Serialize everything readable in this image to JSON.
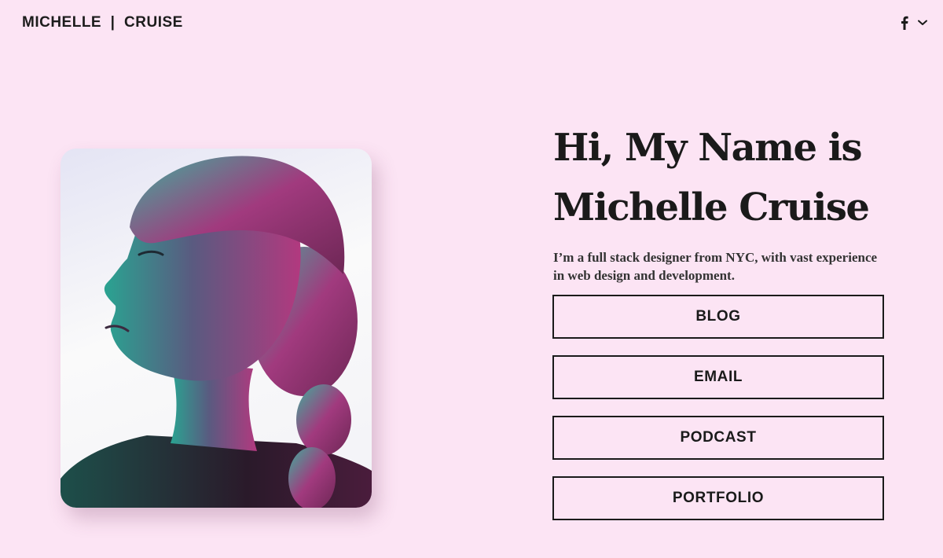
{
  "header": {
    "logo": "MICHELLE  |  CRUISE",
    "social_icon": "facebook-icon",
    "dropdown_icon": "chevron-down-icon"
  },
  "hero": {
    "title_line1": "Hi, My Name is",
    "title_line2": "Michelle Cruise",
    "subtitle": "I’m a full stack designer from NYC, with vast experience in web design and development."
  },
  "buttons": {
    "blog": "BLOG",
    "email": "EMAIL",
    "podcast": "PODCAST",
    "portfolio": "PORTFOLIO"
  },
  "colors": {
    "background": "#fce4f4",
    "text": "#1a1a1a",
    "accent_magenta": "#b0397d",
    "accent_teal": "#2a9b8c"
  }
}
